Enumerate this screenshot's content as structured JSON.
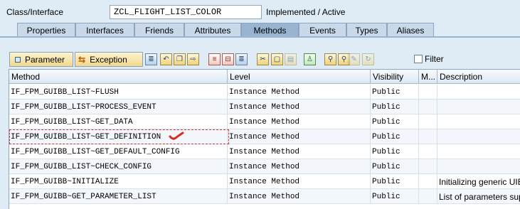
{
  "header": {
    "label": "Class/Interface",
    "class_name": "ZCL_FLIGHT_LIST_COLOR",
    "status": "Implemented / Active"
  },
  "tabs": [
    {
      "label": "Properties"
    },
    {
      "label": "Interfaces"
    },
    {
      "label": "Friends"
    },
    {
      "label": "Attributes"
    },
    {
      "label": "Methods",
      "active": true
    },
    {
      "label": "Events"
    },
    {
      "label": "Types"
    },
    {
      "label": "Aliases"
    }
  ],
  "toolbar": {
    "parameter_label": "Parameter",
    "exception_label": "Exception",
    "filter_label": "Filter"
  },
  "grid": {
    "columns": [
      "Method",
      "Level",
      "Visibility",
      "M...",
      "Description"
    ],
    "rows": [
      {
        "method": "IF_FPM_GUIBB_LIST~FLUSH",
        "level": "Instance Method",
        "visibility": "Public",
        "m": "",
        "description": ""
      },
      {
        "method": "IF_FPM_GUIBB_LIST~PROCESS_EVENT",
        "level": "Instance Method",
        "visibility": "Public",
        "m": "",
        "description": ""
      },
      {
        "method": "IF_FPM_GUIBB_LIST~GET_DATA",
        "level": "Instance Method",
        "visibility": "Public",
        "m": "",
        "description": ""
      },
      {
        "method": "IF_FPM_GUIBB_LIST~GET_DEFINITION",
        "level": "Instance Method",
        "visibility": "Public",
        "m": "",
        "description": ""
      },
      {
        "method": "IF_FPM_GUIBB_LIST~GET_DEFAULT_CONFIG",
        "level": "Instance Method",
        "visibility": "Public",
        "m": "",
        "description": ""
      },
      {
        "method": "IF_FPM_GUIBB_LIST~CHECK_CONFIG",
        "level": "Instance Method",
        "visibility": "Public",
        "m": "",
        "description": ""
      },
      {
        "method": "IF_FPM_GUIBB~INITIALIZE",
        "level": "Instance Method",
        "visibility": "Public",
        "m": "",
        "description": "Initializing generic UIB"
      },
      {
        "method": "IF_FPM_GUIBB~GET_PARAMETER_LIST",
        "level": "Instance Method",
        "visibility": "Public",
        "m": "",
        "description": "List of parameters sup"
      }
    ]
  },
  "colors": {
    "window_bg": "#dfebf5",
    "tab_active": "#98b4d0",
    "tab_inactive": "#c9d9e9",
    "annotation_red": "#d9281f"
  }
}
